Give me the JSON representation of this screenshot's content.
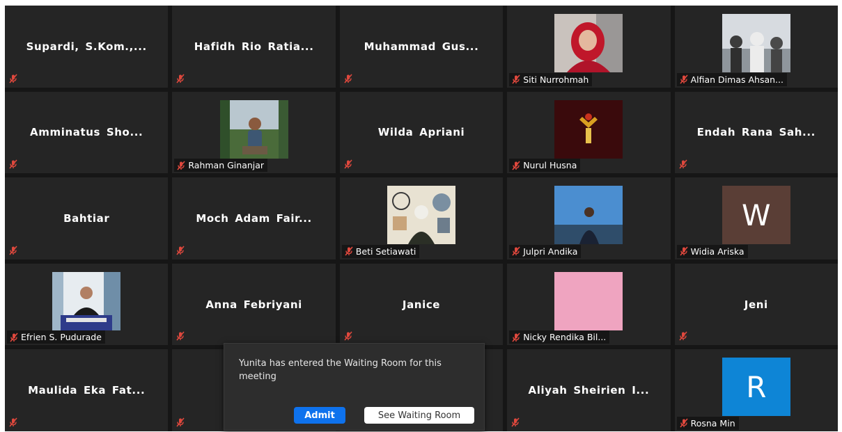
{
  "participants": [
    {
      "name": "Supardi,  S.Kom.,...",
      "type": "name"
    },
    {
      "name": "Hafidh  Rio  Ratia...",
      "type": "name"
    },
    {
      "name": "Muhammad  Gus...",
      "type": "name"
    },
    {
      "name": "Siti Nurrohmah",
      "type": "video",
      "thumb": "photo-hijab"
    },
    {
      "name": "Alfian Dimas Ahsan...",
      "type": "video",
      "thumb": "photo-crowd"
    },
    {
      "name": "Amminatus  Sho...",
      "type": "name"
    },
    {
      "name": "Rahman Ginanjar",
      "type": "video",
      "thumb": "photo-outdoor"
    },
    {
      "name": "Wilda  Apriani",
      "type": "name"
    },
    {
      "name": "Nurul Husna",
      "type": "video",
      "thumb": "photo-dark"
    },
    {
      "name": "Endah  Rana  Sah...",
      "type": "name"
    },
    {
      "name": "Bahtiar",
      "type": "name"
    },
    {
      "name": "Moch  Adam  Fair...",
      "type": "name"
    },
    {
      "name": "Beti Setiawati",
      "type": "video",
      "thumb": "photo-art"
    },
    {
      "name": "Julpri Andika",
      "type": "video",
      "thumb": "photo-sky"
    },
    {
      "name": "Widia Ariska",
      "type": "avatar",
      "letter": "W",
      "color": "#5a3e36"
    },
    {
      "name": "Efrien S. Pudurade",
      "type": "video",
      "thumb": "photo-office"
    },
    {
      "name": "Anna  Febriyani",
      "type": "name"
    },
    {
      "name": "Janice",
      "type": "name"
    },
    {
      "name": "Nicky Rendika Bil...",
      "type": "video",
      "thumb": "photo-pink"
    },
    {
      "name": "Jeni",
      "type": "name"
    },
    {
      "name": "Maulida  Eka  Fat...",
      "type": "name"
    },
    {
      "name": "",
      "type": "blank"
    },
    {
      "name": "",
      "type": "blank"
    },
    {
      "name": "Aliyah  Sheirien  I...",
      "type": "name"
    },
    {
      "name": "Rosna Min",
      "type": "avatar",
      "letter": "R",
      "color": "#0e85d6"
    }
  ],
  "waiting_room_toast": {
    "message": "Yunita has entered the Waiting Room for this meeting",
    "admit_label": "Admit",
    "see_waiting_room_label": "See Waiting Room"
  },
  "colors": {
    "accent": "#0e72ed",
    "tile_bg": "#252525",
    "muted_mic": "#e0483d"
  }
}
